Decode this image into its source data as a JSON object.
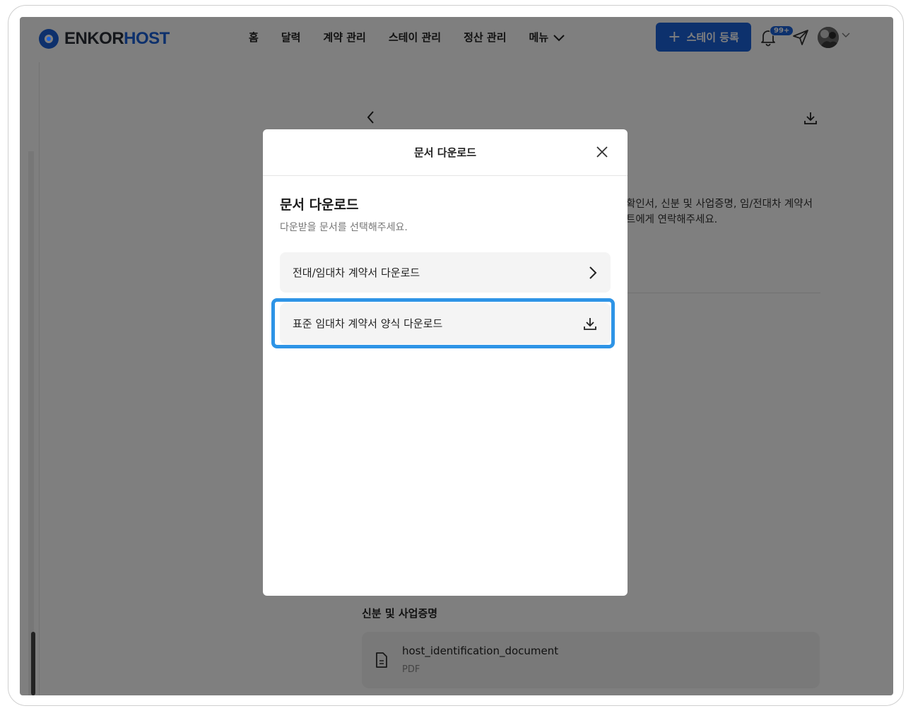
{
  "brand": {
    "part1": "ENKOR",
    "part2": "HOST"
  },
  "nav": {
    "items": [
      "홈",
      "달력",
      "계약 관리",
      "스테이 관리",
      "정산 관리"
    ],
    "more_label": "메뉴",
    "cta_label": "스테이 등록",
    "notification_count": "99+"
  },
  "background": {
    "info_line1": "확인서, 신분 및 사업증명, 임/전대차 계약서",
    "info_line2": "트에게 연락해주세요.",
    "section_title": "신분 및 사업증명",
    "file": {
      "name": "host_identification_document",
      "type": "PDF"
    }
  },
  "modal": {
    "title": "문서 다운로드",
    "heading": "문서 다운로드",
    "subtitle": "다운받을 문서를 선택해주세요.",
    "options": [
      {
        "label": "전대/임대차 계약서 다운로드",
        "icon": "chevron-right-icon"
      },
      {
        "label": "표준 임대차 계약서 양식 다운로드",
        "icon": "download-icon"
      }
    ]
  },
  "colors": {
    "brand_blue": "#1b62db",
    "focus_ring": "#2e94e6"
  }
}
